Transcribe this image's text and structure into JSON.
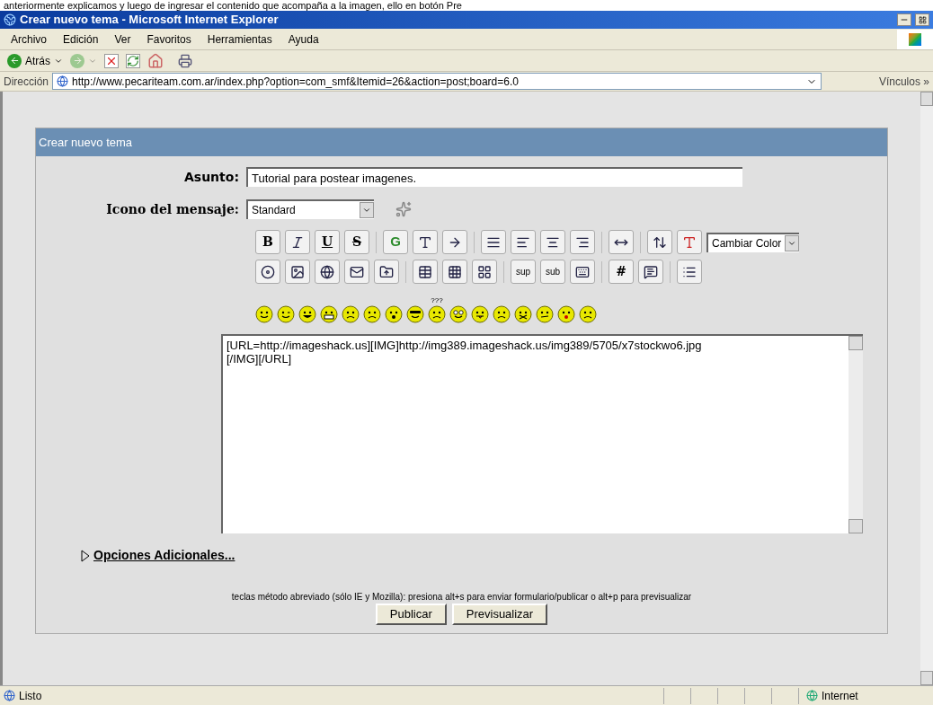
{
  "caption_above": "anteriormente explicamos y luego de ingresar el contenido que acompaña a la imagen, ello en botón Pre",
  "window": {
    "title": "Crear nuevo tema - Microsoft Internet Explorer"
  },
  "menu": [
    "Archivo",
    "Edición",
    "Ver",
    "Favoritos",
    "Herramientas",
    "Ayuda"
  ],
  "toolbar": {
    "back_label": "Atrás",
    "forward_disabled": true
  },
  "address": {
    "label": "Dirección",
    "url": "http://www.pecariteam.com.ar/index.php?option=com_smf&Itemid=26&action=post;board=6.0",
    "links_label": "Vínculos",
    "links_more": "»"
  },
  "form": {
    "title": "Crear nuevo tema",
    "subject_label": "Asunto:",
    "subject_value": "Tutorial para postear imagenes.",
    "icon_label": "Icono del mensaje:",
    "icon_value": "Standard",
    "format_rows": [
      [
        {
          "kind": "letter",
          "label": "B"
        },
        {
          "kind": "icon"
        },
        {
          "kind": "letter",
          "label": "U"
        },
        {
          "kind": "letter",
          "label": "S"
        },
        {
          "kind": "separator"
        },
        {
          "kind": "letter",
          "label": "G"
        },
        {
          "kind": "icon"
        },
        {
          "kind": "icon"
        },
        {
          "kind": "separator"
        },
        {
          "kind": "icon"
        },
        {
          "kind": "icon"
        },
        {
          "kind": "icon"
        },
        {
          "kind": "icon"
        },
        {
          "kind": "separator"
        },
        {
          "kind": "icon"
        },
        {
          "kind": "separator"
        },
        {
          "kind": "icon"
        },
        {
          "kind": "icon"
        },
        {
          "kind": "select",
          "label": "Cambiar Color"
        }
      ],
      [
        {
          "kind": "icon"
        },
        {
          "kind": "icon"
        },
        {
          "kind": "icon"
        },
        {
          "kind": "icon"
        },
        {
          "kind": "icon"
        },
        {
          "kind": "separator"
        },
        {
          "kind": "icon"
        },
        {
          "kind": "icon"
        },
        {
          "kind": "icon"
        },
        {
          "kind": "separator"
        },
        {
          "kind": "letter",
          "label": "sup"
        },
        {
          "kind": "letter",
          "label": "sub"
        },
        {
          "kind": "icon"
        },
        {
          "kind": "separator"
        },
        {
          "kind": "letter",
          "label": "#"
        },
        {
          "kind": "icon"
        },
        {
          "kind": "separator"
        },
        {
          "kind": "icon"
        }
      ]
    ],
    "smileys": [
      {
        "kind": "smile"
      },
      {
        "kind": "wink"
      },
      {
        "kind": "cheesy"
      },
      {
        "kind": "grin"
      },
      {
        "kind": "angry"
      },
      {
        "kind": "sad"
      },
      {
        "kind": "shocked"
      },
      {
        "kind": "cool"
      },
      {
        "kind": "huh",
        "caption": "???"
      },
      {
        "kind": "rolleyes"
      },
      {
        "kind": "tongue"
      },
      {
        "kind": "sad"
      },
      {
        "kind": "sealed"
      },
      {
        "kind": "undecided"
      },
      {
        "kind": "kiss"
      },
      {
        "kind": "sad"
      }
    ],
    "message_lines": [
      "[URL=http://imageshack.us][IMG]http://img389.imageshack.us/img389/5705/x7stockwo6.jpg",
      "[/IMG][/URL]"
    ],
    "options_link": "Opciones Adicionales...",
    "options_expanded": false,
    "shortcut_note": "teclas método abreviado (sólo IE y Mozilla): presiona alt+s para enviar formulario/publicar o alt+p para previsualizar",
    "buttons": [
      "Publicar",
      "Previsualizar"
    ]
  },
  "status_bar": {
    "text": "Listo",
    "zone": "Internet"
  }
}
